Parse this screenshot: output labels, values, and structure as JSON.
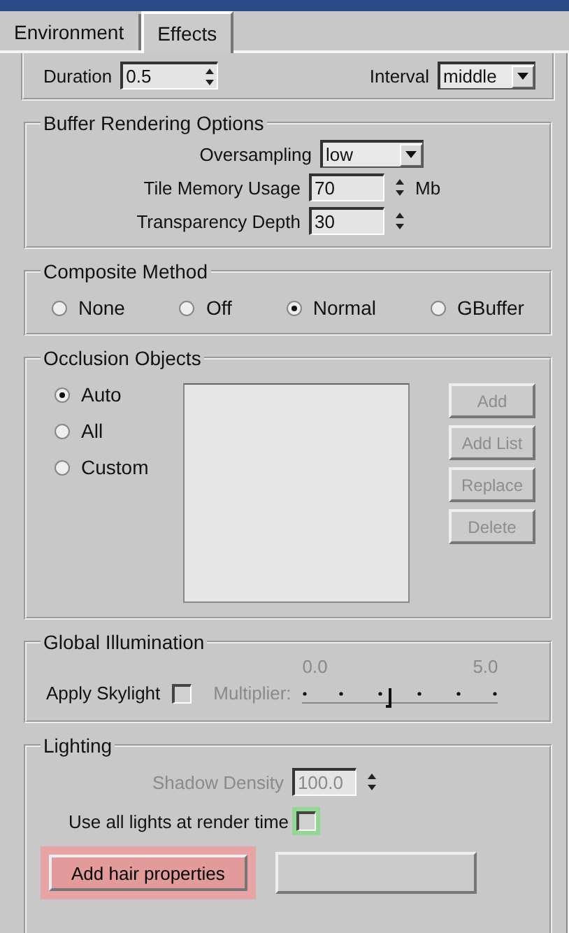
{
  "tabs": [
    {
      "label": "Environment",
      "selected": false
    },
    {
      "label": "Effects",
      "selected": true
    }
  ],
  "top_row": {
    "duration_label": "Duration",
    "duration_value": "0.5",
    "interval_label": "Interval",
    "interval_value": "middle"
  },
  "buffer_rendering": {
    "title": "Buffer Rendering Options",
    "oversampling": {
      "label": "Oversampling",
      "value": "low"
    },
    "tile_memory": {
      "label": "Tile Memory Usage",
      "value": "70",
      "unit": "Mb"
    },
    "transparency_depth": {
      "label": "Transparency Depth",
      "value": "30"
    }
  },
  "composite_method": {
    "title": "Composite Method",
    "options": [
      {
        "label": "None",
        "selected": false
      },
      {
        "label": "Off",
        "selected": false
      },
      {
        "label": "Normal",
        "selected": true
      },
      {
        "label": "GBuffer",
        "selected": false
      }
    ]
  },
  "occlusion": {
    "title": "Occlusion Objects",
    "options": [
      {
        "label": "Auto",
        "selected": true
      },
      {
        "label": "All",
        "selected": false
      },
      {
        "label": "Custom",
        "selected": false
      }
    ],
    "buttons": [
      {
        "label": "Add",
        "disabled": true
      },
      {
        "label": "Add List",
        "disabled": true
      },
      {
        "label": "Replace",
        "disabled": true
      },
      {
        "label": "Delete",
        "disabled": true
      }
    ]
  },
  "global_illumination": {
    "title": "Global Illumination",
    "apply_skylight": {
      "label": "Apply Skylight",
      "checked": false
    },
    "multiplier": {
      "label": "Multiplier:",
      "disabled": true,
      "min_label": "0.0",
      "max_label": "5.0",
      "level": 0.43
    }
  },
  "lighting": {
    "title": "Lighting",
    "shadow_density": {
      "label": "Shadow Density",
      "value": "100.0",
      "disabled": true
    },
    "use_all_lights": {
      "label": "Use all lights at render time",
      "checked": false,
      "highlighted": true
    },
    "buttons": [
      {
        "label": "Add hair properties",
        "highlighted": true
      }
    ]
  }
}
